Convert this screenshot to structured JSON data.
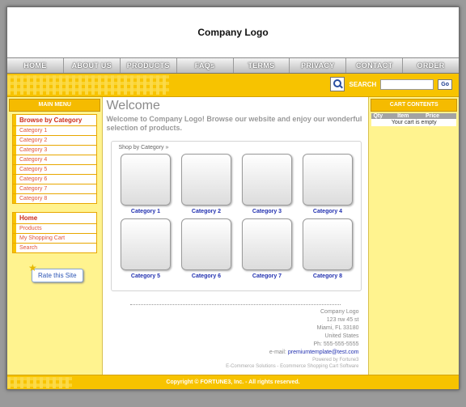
{
  "header": {
    "logo_text": "Company Logo"
  },
  "nav": [
    "HOME",
    "ABOUT US",
    "PRODUCTS",
    "FAQs",
    "TERMS",
    "PRIVACY",
    "CONTACT",
    "ORDER STATUS"
  ],
  "search": {
    "label": "SEARCH",
    "go_label": "Go",
    "placeholder": ""
  },
  "left": {
    "main_menu_title": "MAIN MENU",
    "browse_title": "Browse by Category",
    "categories": [
      "Category 1",
      "Category 2",
      "Category 3",
      "Category 4",
      "Category 5",
      "Category 6",
      "Category 7",
      "Category 8"
    ],
    "links": [
      "Home",
      "Products",
      "My Shopping Cart",
      "Search"
    ],
    "rate_label": "Rate this Site"
  },
  "main": {
    "title": "Welcome",
    "intro": "Welcome to  Company Logo! Browse our website and enjoy our wonderful selection of products.",
    "shop_title": "Shop by Category »",
    "shop_categories": [
      "Category 1",
      "Category 2",
      "Category 3",
      "Category 4",
      "Category 5",
      "Category 6",
      "Category 7",
      "Category 8"
    ],
    "address": {
      "name": "Company Logo",
      "street": "123 nw 45 st",
      "city": "Miami, FL 33180",
      "country": "United States",
      "phone": "Ph: 555-555-5555",
      "email_prefix": "e-mail:",
      "email": "premiumtemplate@test.com",
      "powered": "Powered by Fortune3",
      "solutions": "E-Commerce Solutions - Ecommerce Shopping Cart Software"
    }
  },
  "cart": {
    "title": "CART CONTENTS",
    "headers": [
      "Qty",
      "Item",
      "Price"
    ],
    "empty_text": "Your cart is empty"
  },
  "footer": {
    "copyright": "Copyright © FORTUNE3, Inc. - All rights reserved."
  }
}
